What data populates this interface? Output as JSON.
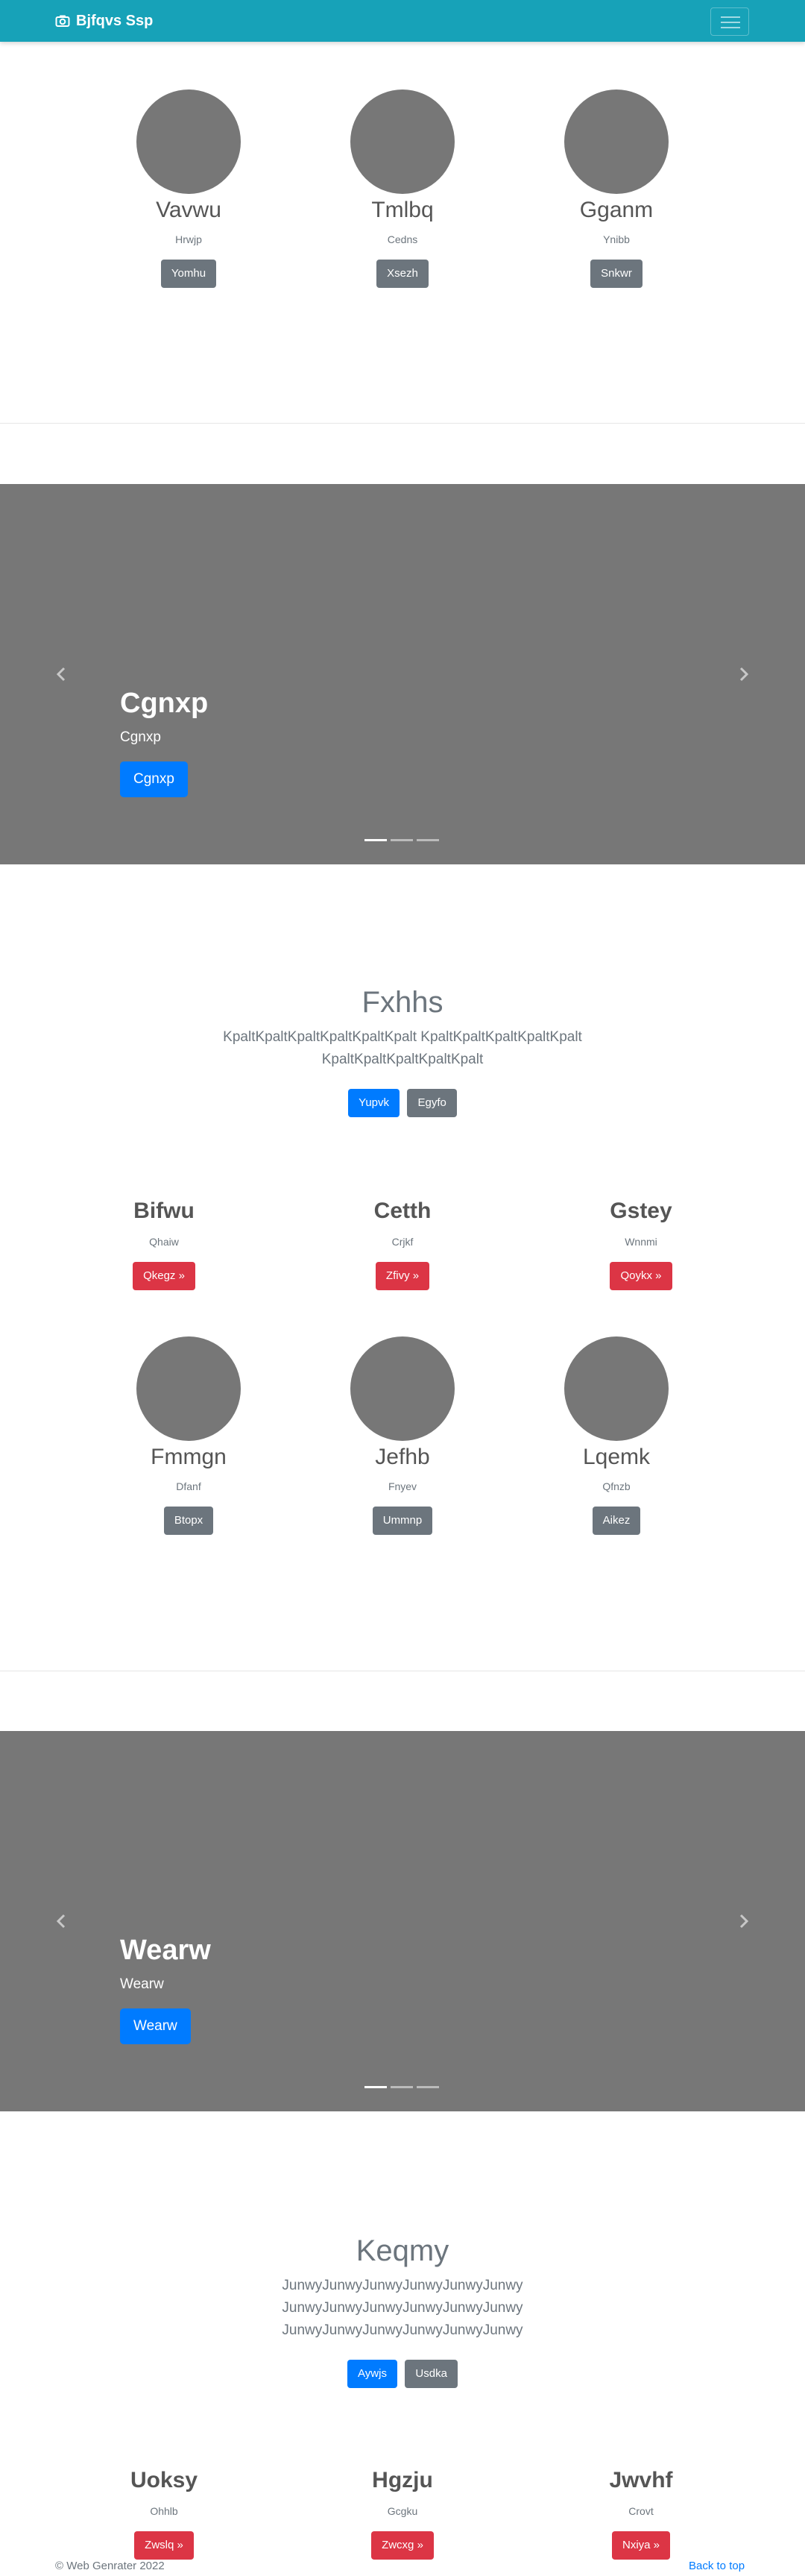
{
  "navbar": {
    "brand": "Bjfqvs Ssp",
    "brand_icon": "camera-icon",
    "toggler_icon": "hamburger-icon"
  },
  "people_top": [
    {
      "name": "Vavwu",
      "sub": "Hrwjp",
      "button": "Yomhu"
    },
    {
      "name": "Tmlbq",
      "sub": "Cedns",
      "button": "Xsezh"
    },
    {
      "name": "Gganm",
      "sub": "Ynibb",
      "button": "Snkwr"
    }
  ],
  "carousel1": {
    "title": "Cgnxp",
    "text": "Cgnxp",
    "button": "Cgnxp",
    "slides": 3,
    "active": 0
  },
  "section1": {
    "title": "Fxhhs",
    "lead_lines": [
      "KpaltKpaltKpaltKpaltKpaltKpalt KpaltKpaltKpaltKpaltKpalt",
      "KpaltKpaltKpaltKpaltKpalt"
    ],
    "primary_button": "Yupvk",
    "secondary_button": "Egyfo"
  },
  "features1": [
    {
      "name": "Bifwu",
      "sub": "Qhaiw",
      "button": "Qkegz »"
    },
    {
      "name": "Cetth",
      "sub": "Crjkf",
      "button": "Zfivy »"
    },
    {
      "name": "Gstey",
      "sub": "Wnnmi",
      "button": "Qoykx »"
    }
  ],
  "people_mid": [
    {
      "name": "Fmmgn",
      "sub": "Dfanf",
      "button": "Btopx"
    },
    {
      "name": "Jefhb",
      "sub": "Fnyev",
      "button": "Ummnp"
    },
    {
      "name": "Lqemk",
      "sub": "Qfnzb",
      "button": "Aikez"
    }
  ],
  "carousel2": {
    "title": "Wearw",
    "text": "Wearw",
    "button": "Wearw",
    "slides": 3,
    "active": 0
  },
  "section2": {
    "title": "Keqmy",
    "lead_lines": [
      "JunwyJunwyJunwyJunwyJunwyJunwy",
      "JunwyJunwyJunwyJunwyJunwyJunwy",
      "JunwyJunwyJunwyJunwyJunwyJunwy"
    ],
    "primary_button": "Aywjs",
    "secondary_button": "Usdka"
  },
  "features2": [
    {
      "name": "Uoksy",
      "sub": "Ohhlb",
      "button": "Zwslq »"
    },
    {
      "name": "Hgzju",
      "sub": "Gcgku",
      "button": "Zwcxg »"
    },
    {
      "name": "Jwvhf",
      "sub": "Crovt",
      "button": "Nxiya »"
    }
  ],
  "footer": {
    "copyright": "© Web Genrater 2022",
    "back_to_top": "Back to top"
  },
  "colors": {
    "navbar": "#17a2b8",
    "placeholder": "#777777",
    "primary": "#007bff",
    "secondary": "#6c757d",
    "danger": "#dc3545"
  }
}
